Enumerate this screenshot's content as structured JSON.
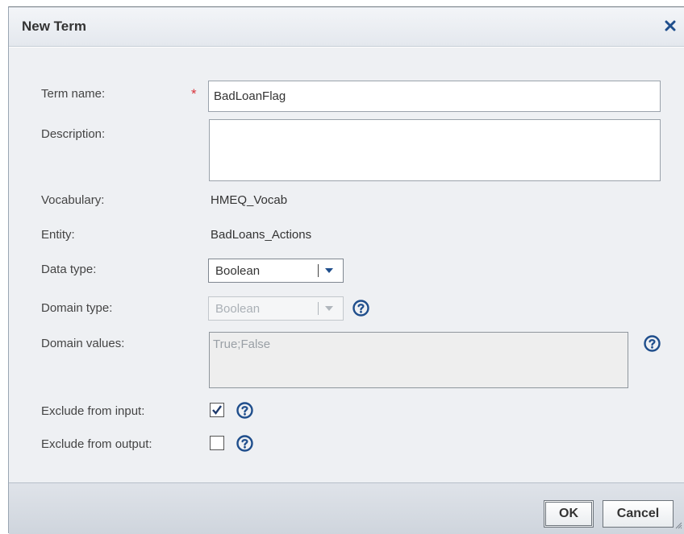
{
  "dialog": {
    "title": "New Term",
    "close_icon": "close-icon"
  },
  "form": {
    "term_name": {
      "label": "Term name:",
      "value": "BadLoanFlag",
      "required_marker": "*"
    },
    "description": {
      "label": "Description:",
      "value": ""
    },
    "vocabulary": {
      "label": "Vocabulary:",
      "value": "HMEQ_Vocab"
    },
    "entity": {
      "label": "Entity:",
      "value": "BadLoans_Actions"
    },
    "data_type": {
      "label": "Data type:",
      "selected": "Boolean"
    },
    "domain_type": {
      "label": "Domain type:",
      "selected": "Boolean"
    },
    "domain_values": {
      "label": "Domain values:",
      "value": "True;False"
    },
    "exclude_input": {
      "label": "Exclude from input:",
      "checked": true
    },
    "exclude_output": {
      "label": "Exclude from output:",
      "checked": false
    }
  },
  "footer": {
    "ok_label": "OK",
    "cancel_label": "Cancel"
  },
  "colors": {
    "accent": "#1f4e8c",
    "required": "#d8333b"
  }
}
